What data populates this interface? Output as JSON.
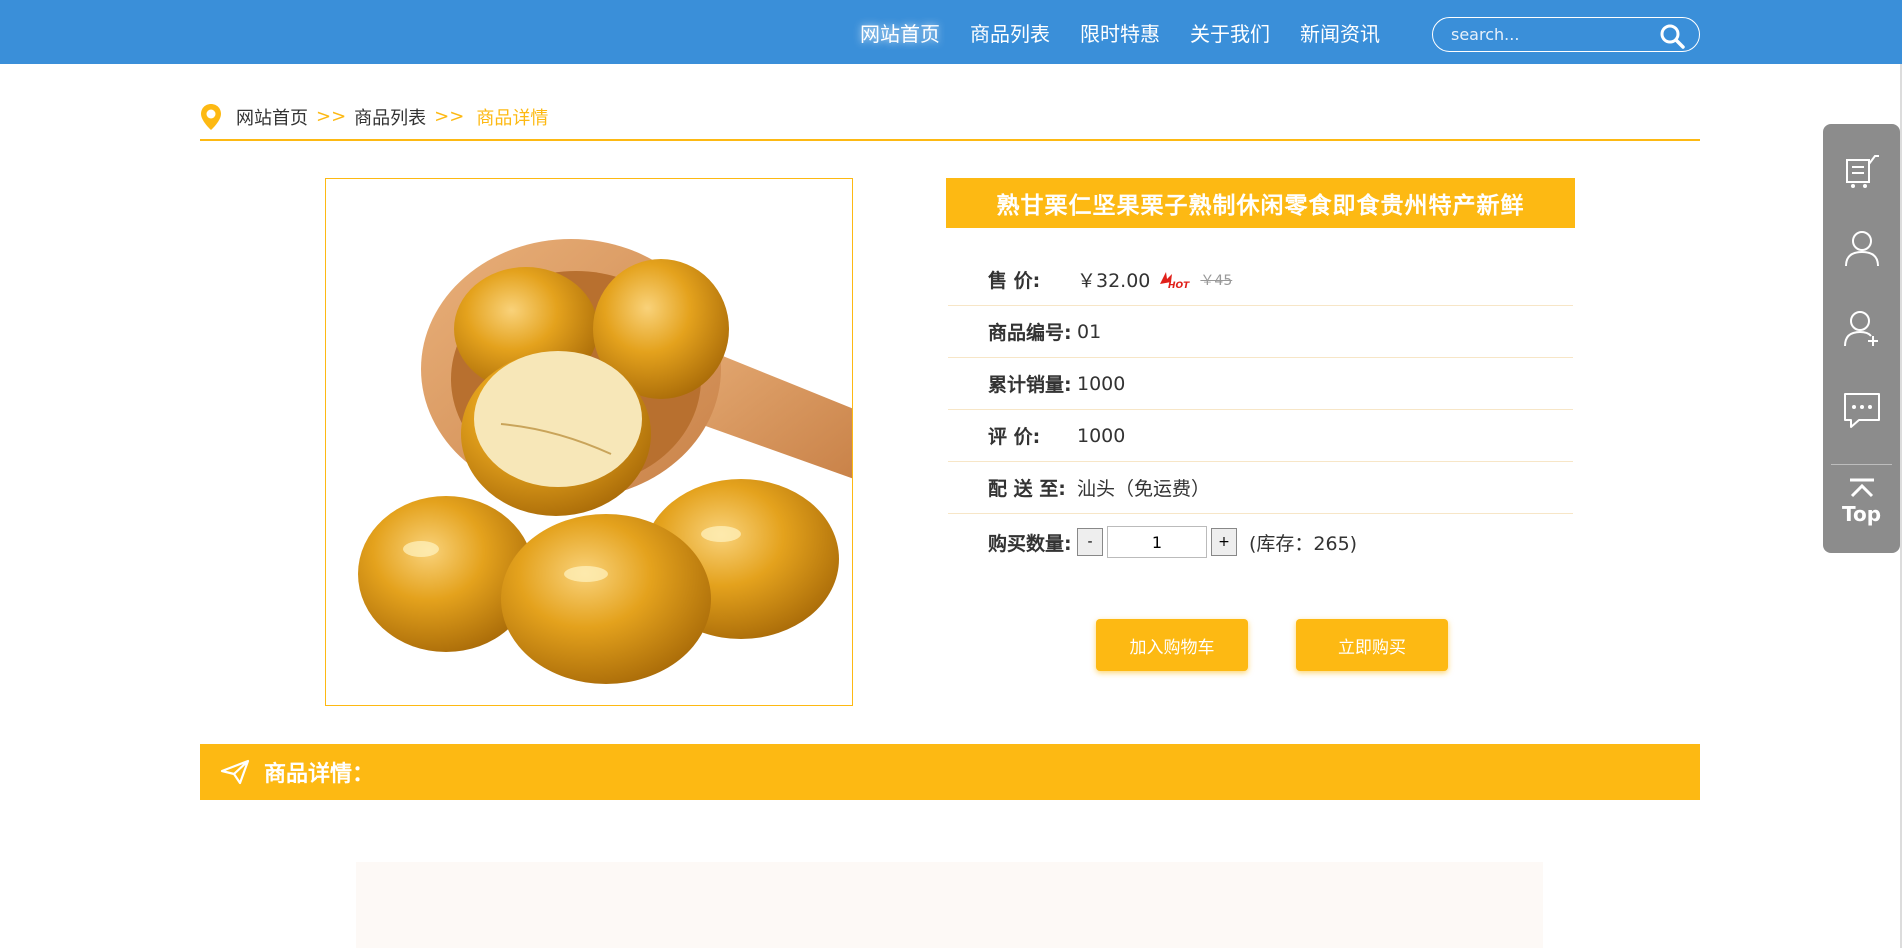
{
  "nav": {
    "items": [
      "网站首页",
      "商品列表",
      "限时特惠",
      "关于我们",
      "新闻资讯"
    ],
    "search_placeholder": "search..."
  },
  "breadcrumb": {
    "home": "网站首页",
    "list": "商品列表",
    "sep": ">>",
    "current": "商品详情"
  },
  "product": {
    "title": "熟甘栗仁坚果栗子熟制休闲零食即食贵州特产新鲜",
    "price_label": "售  价:",
    "price": "￥32.00",
    "old_price": "￥45",
    "code_label": "商品编号:",
    "code": "01",
    "sales_label": "累计销量:",
    "sales": "1000",
    "rating_label": "评  价:",
    "rating": "1000",
    "ship_label": "配 送 至:",
    "ship": "汕头（免运费）",
    "qty_label": "购买数量:",
    "qty_minus": "-",
    "qty_value": "1",
    "qty_plus": "+",
    "stock": "(库存：265)"
  },
  "buttons": {
    "add_cart": "加入购物车",
    "buy_now": "立即购买"
  },
  "details": {
    "heading": "商品详情："
  },
  "sidebar": {
    "top_label": "Top",
    "icons": [
      "cart-list-icon",
      "user-icon",
      "add-user-icon",
      "message-icon",
      "back-to-top-icon"
    ]
  },
  "colors": {
    "nav_bg": "#3a8fd9",
    "accent": "#fdb913",
    "side_bg": "#8c8c8c"
  }
}
